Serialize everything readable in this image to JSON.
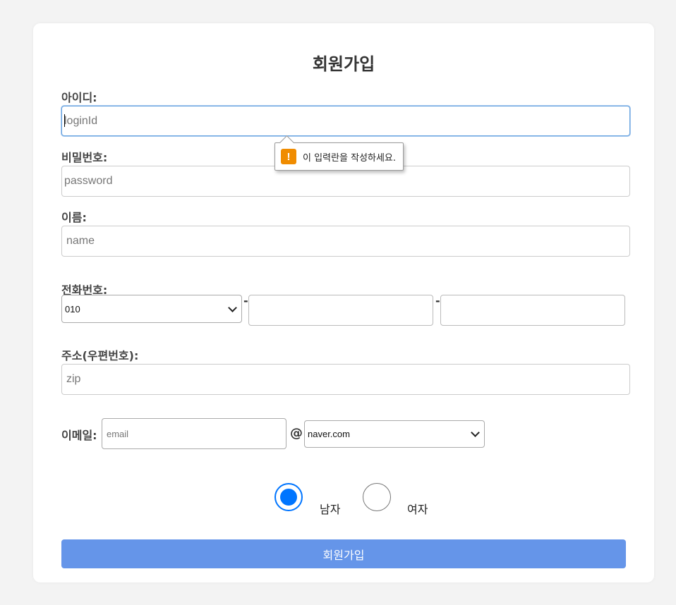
{
  "form": {
    "title": "회원가입",
    "login_id": {
      "label": "아이디:",
      "placeholder": "loginId",
      "value": ""
    },
    "password": {
      "label": "비밀번호:",
      "placeholder": "password",
      "value": ""
    },
    "name": {
      "label": "이름:",
      "placeholder": "name",
      "value": ""
    },
    "phone": {
      "label": "전화번호:",
      "prefix_selected": "010",
      "separator": "-",
      "middle_value": "",
      "last_value": ""
    },
    "zip": {
      "label": "주소(우편번호):",
      "placeholder": "zip",
      "value": ""
    },
    "email": {
      "label": "이메일:",
      "placeholder": "email",
      "at_symbol": "@",
      "domain_selected": "naver.com"
    },
    "gender": {
      "options": [
        {
          "label": "남자",
          "checked": true
        },
        {
          "label": "여자",
          "checked": false
        }
      ]
    },
    "submit_label": "회원가입"
  },
  "validation_tooltip": {
    "icon": "warning-icon",
    "icon_glyph": "!",
    "message": "이 입력란을 작성하세요."
  },
  "colors": {
    "accent": "#0075ff",
    "submit_bg": "#6595e9",
    "warning": "#f08c00",
    "focus_border": "#66a3e0"
  }
}
